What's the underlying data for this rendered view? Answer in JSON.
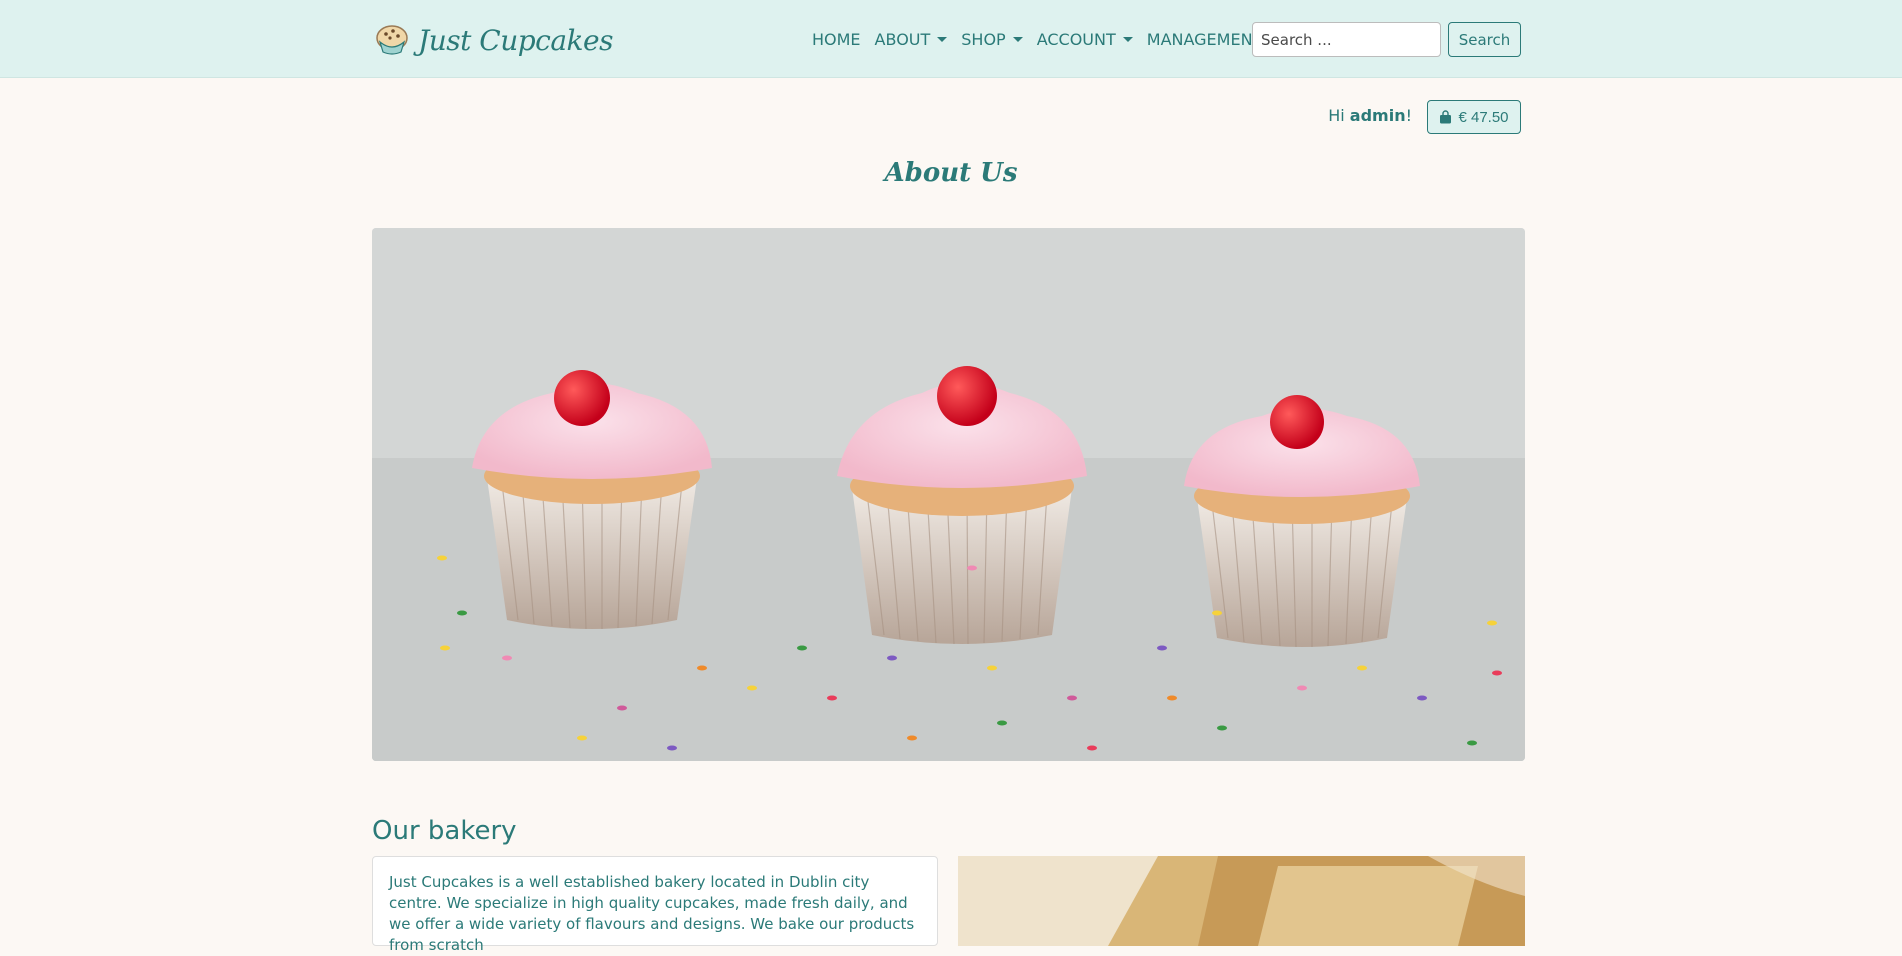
{
  "brand": {
    "name": "Just Cupcakes"
  },
  "nav": {
    "home": "HOME",
    "about": "ABOUT",
    "shop": "SHOP",
    "account": "ACCOUNT",
    "management": "MANAGEMENT"
  },
  "search": {
    "placeholder": "Search ...",
    "button": "Search"
  },
  "user": {
    "greeting_prefix": "Hi ",
    "username": "admin",
    "greeting_suffix": "!"
  },
  "cart": {
    "total": "€ 47.50"
  },
  "page": {
    "title": "About Us"
  },
  "section": {
    "title": "Our bakery",
    "text": "Just Cupcakes is a well established bakery located in Dublin city centre. We specialize in high quality cupcakes, made fresh daily, and we offer a wide variety of flavours and designs. We bake our products from scratch"
  },
  "icons": {
    "brand": "cupcake-logo-icon",
    "cart": "shopping-bag-icon"
  },
  "colors": {
    "primary": "#2b7a78",
    "navbar_bg": "#def2ef",
    "page_bg": "#fcf8f4"
  }
}
